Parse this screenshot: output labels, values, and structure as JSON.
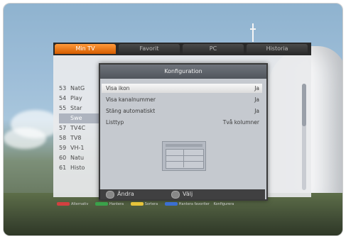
{
  "tabs": [
    {
      "label": "Min TV",
      "active": true
    },
    {
      "label": "Favorit",
      "active": false
    },
    {
      "label": "PC",
      "active": false
    },
    {
      "label": "Historia",
      "active": false
    }
  ],
  "channel_list": [
    {
      "num": "53",
      "name": "NatG"
    },
    {
      "num": "54",
      "name": "Play"
    },
    {
      "num": "55",
      "name": "Star"
    },
    {
      "num": "",
      "name": "Swe",
      "highlighted": true
    },
    {
      "num": "57",
      "name": "TV4C"
    },
    {
      "num": "58",
      "name": "TV8"
    },
    {
      "num": "59",
      "name": "VH-1"
    },
    {
      "num": "60",
      "name": "Natu"
    },
    {
      "num": "61",
      "name": "Histo"
    }
  ],
  "dialog": {
    "title": "Konfiguration",
    "settings": [
      {
        "label": "Visa ikon",
        "value": "Ja",
        "highlighted": true
      },
      {
        "label": "Visa kanalnummer",
        "value": "Ja",
        "highlighted": false
      },
      {
        "label": "Stäng automatiskt",
        "value": "Ja",
        "highlighted": false
      },
      {
        "label": "Listtyp",
        "value": "Två kolumner",
        "highlighted": false
      }
    ],
    "footer": {
      "change_label": "Ändra",
      "select_label": "Välj"
    }
  },
  "legend": {
    "items": [
      "Alternativ",
      "Hantera",
      "Sortera",
      "Hantera favoriter",
      "Konfigurera"
    ]
  },
  "colors": {
    "tab_active": "#e06a00",
    "tab_inactive": "#3a3a3a",
    "highlight_row": "#aeb4bf",
    "legend_red": "#d24040",
    "legend_green": "#3aa24a",
    "legend_yellow": "#e6c43a",
    "legend_blue": "#3b6fd1"
  }
}
